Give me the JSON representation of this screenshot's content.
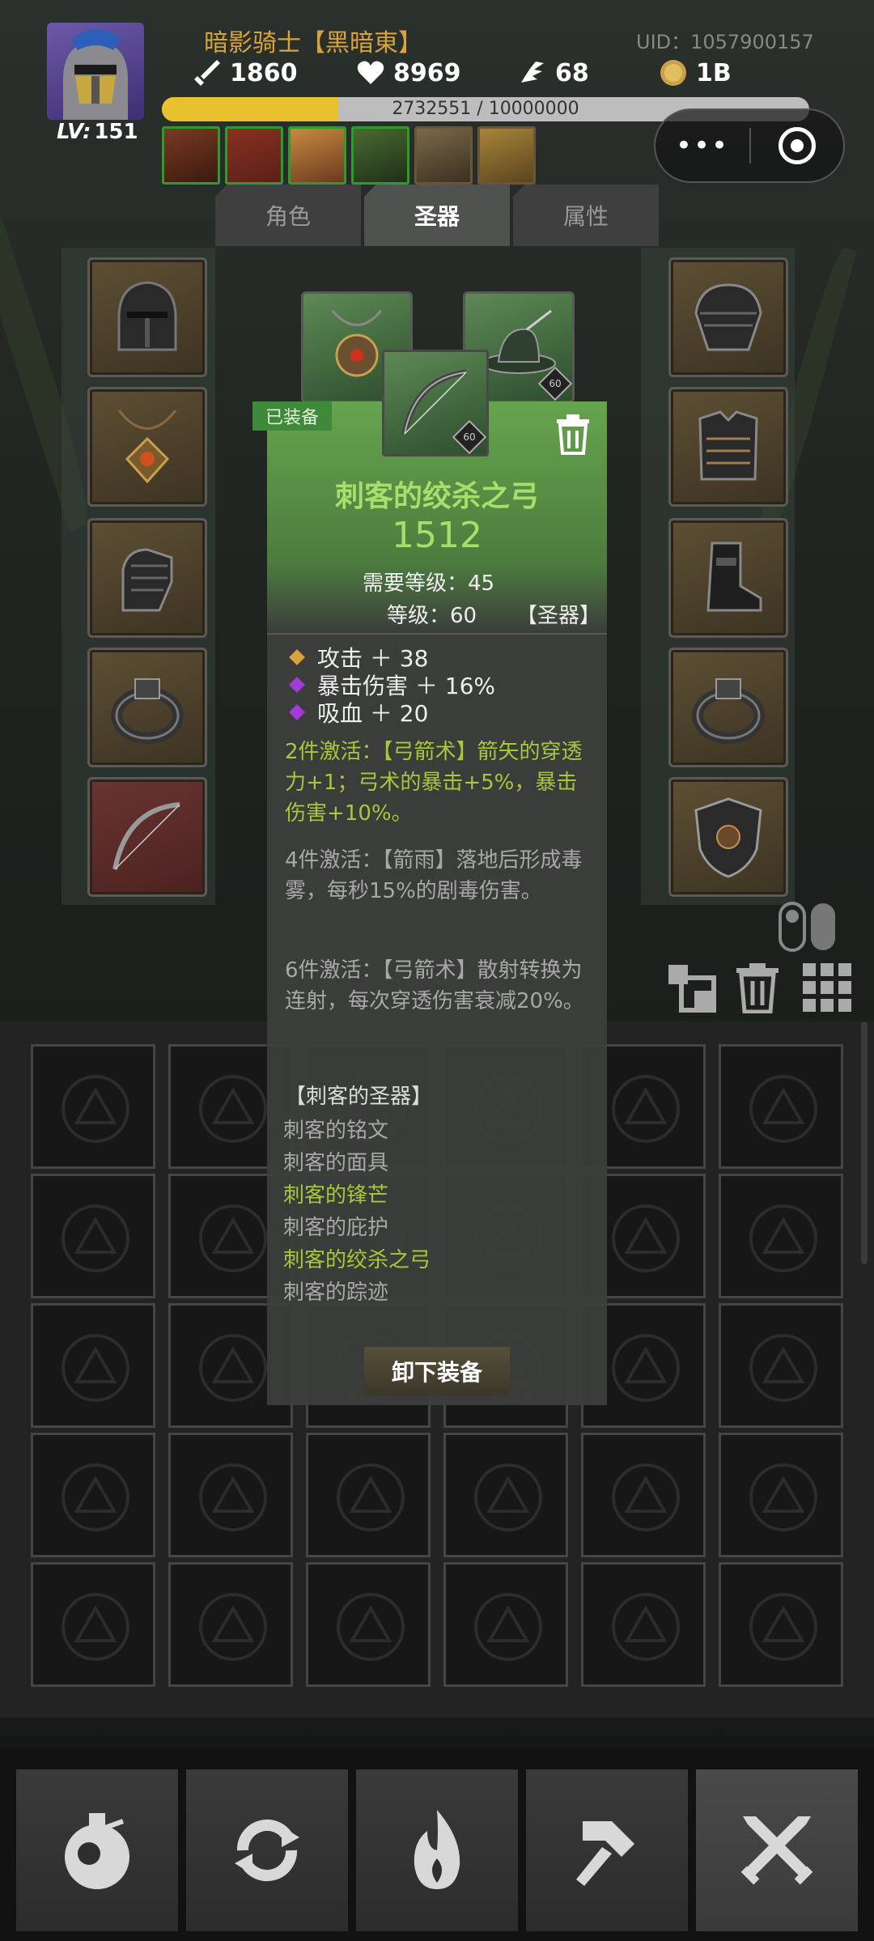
{
  "header": {
    "player_name": "暗影骑士【黑暗東】",
    "uid": "UID：1057900157",
    "level_prefix": "LV:",
    "level": "151",
    "attack": "1860",
    "hp": "8969",
    "speed": "68",
    "gold": "1B",
    "xp_text": "2732551 / 10000000",
    "xp_progress": 0.273
  },
  "buffs": [
    "buff-1",
    "buff-2",
    "buff-3",
    "buff-4",
    "buff-5",
    "buff-6"
  ],
  "tabs": [
    {
      "label": "角色",
      "active": false
    },
    {
      "label": "圣器",
      "active": true
    },
    {
      "label": "属性",
      "active": false
    }
  ],
  "left_slots": [
    "helmet-icon",
    "amulet-icon",
    "gauntlet-icon",
    "ring-icon",
    "bow-icon"
  ],
  "right_slots": [
    "shoulder-armor-icon",
    "chest-armor-icon",
    "boots-icon",
    "ring-icon",
    "shield-icon"
  ],
  "middle_slots": [
    {
      "icon": "amulet-icon",
      "level": ""
    },
    {
      "icon": "hat-icon",
      "level": "60"
    }
  ],
  "tooltip": {
    "equipped_tag": "已装备",
    "item_icon_level": "60",
    "name": "刺客的绞杀之弓",
    "power": "1512",
    "required_level": "需要等级：45",
    "item_level": "等级：60",
    "category": "【圣器】",
    "attributes": [
      {
        "text": "攻击 ＋ 38",
        "color": "#d9a33b"
      },
      {
        "text": "暴击伤害 ＋ 16%",
        "color": "#a23bd9"
      },
      {
        "text": "吸血 ＋ 20",
        "color": "#a23bd9"
      }
    ],
    "set_bonus_2": "2件激活：【弓箭术】箭矢的穿透力+1；弓术的暴击+5%，暴击伤害+10%。",
    "set_bonus_4": "4件激活：【箭雨】落地后形成毒雾，每秒15%的剧毒伤害。",
    "set_bonus_6": "6件激活：【弓箭术】散射转换为连射，每次穿透伤害衰减20%。",
    "set_title": "【刺客的圣器】",
    "set_items": [
      {
        "name": "刺客的铭文",
        "owned": false
      },
      {
        "name": "刺客的面具",
        "owned": false
      },
      {
        "name": "刺客的锋芒",
        "owned": true
      },
      {
        "name": "刺客的庇护",
        "owned": false
      },
      {
        "name": "刺客的绞杀之弓",
        "owned": true
      },
      {
        "name": "刺客的踪迹",
        "owned": false
      }
    ],
    "unequip_label": "卸下装备"
  },
  "bottom_nav": [
    {
      "icon": "potion-icon",
      "active": false
    },
    {
      "icon": "refresh-icon",
      "active": false
    },
    {
      "icon": "flame-icon",
      "active": false
    },
    {
      "icon": "hammer-icon",
      "active": false
    },
    {
      "icon": "crossed-swords-icon",
      "active": true
    }
  ],
  "colors": {
    "gold_text": "#d9a33b",
    "item_green": "#a6e06a",
    "set_active": "#a6c83a",
    "xp_fill": "#e8c22e"
  }
}
